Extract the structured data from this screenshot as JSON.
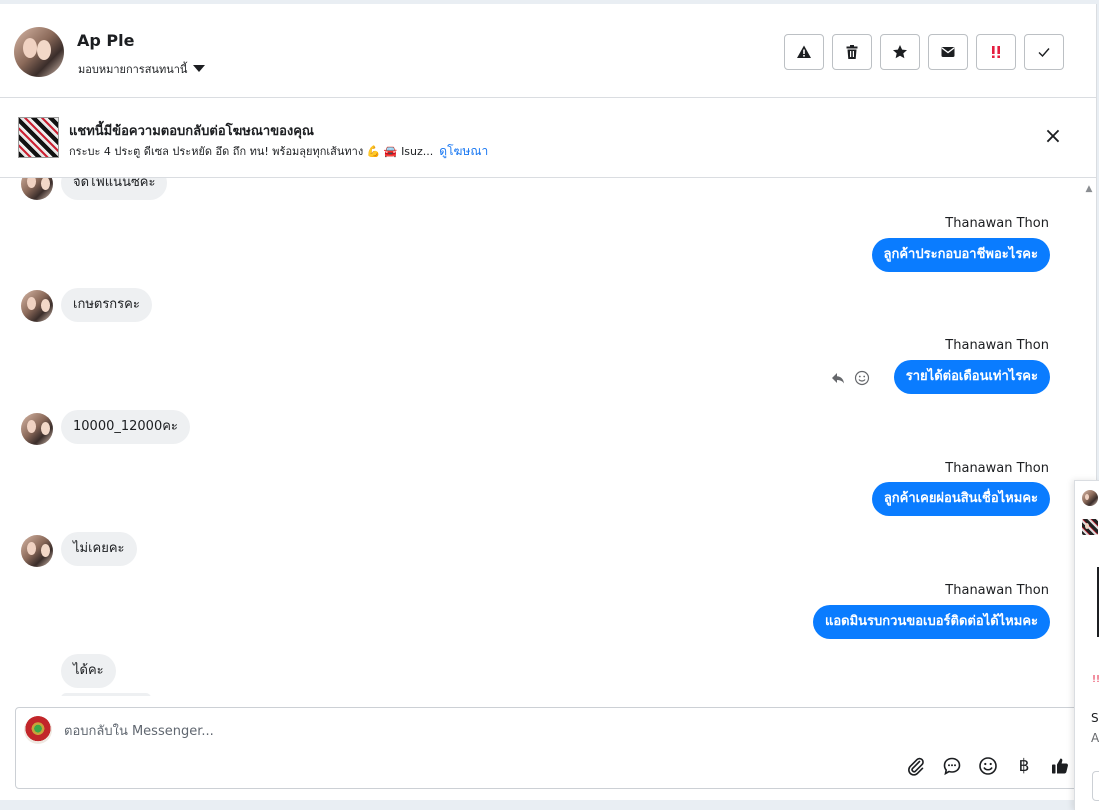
{
  "header": {
    "contact_name": "Ap Ple",
    "assign_label": "มอบหมายการสนทนานี้",
    "actions": [
      "warning-icon",
      "trash-icon",
      "star-icon",
      "mail-icon",
      "spam-icon",
      "check-icon"
    ]
  },
  "ad": {
    "title": "แชทนี้มีข้อความตอบกลับต่อโฆษณาของคุณ",
    "description": "กระบะ 4 ประตู ดีเซล ประหยัด อึด ถึก ทน! พร้อมลุยทุกเส้นทาง 💪 🚘 Isuz...",
    "link": "ดูโฆษณา",
    "close": "×"
  },
  "messages": [
    {
      "dir": "in",
      "text": "จัดไฟแนนซ์คะ"
    },
    {
      "dir": "out",
      "sender": "Thanawan Thon",
      "text": "ลูกค้าประกอบอาชีพอะไรคะ"
    },
    {
      "dir": "in",
      "text": "เกษตรกรคะ"
    },
    {
      "dir": "out",
      "sender": "Thanawan Thon",
      "text": "รายได้ต่อเดือนเท่าไรคะ"
    },
    {
      "dir": "in",
      "text": "10000_12000คะ"
    },
    {
      "dir": "out",
      "sender": "Thanawan Thon",
      "text": "ลูกค้าเคยผ่อนสินเชื่อไหมคะ"
    },
    {
      "dir": "in",
      "text": "ไม่เคยคะ"
    },
    {
      "dir": "out",
      "sender": "Thanawan Thon",
      "text": "แอดมินรบกวนขอเบอร์ติดต่อได้ไหมคะ"
    },
    {
      "dir": "in",
      "text": "ได้คะ"
    }
  ],
  "composer": {
    "placeholder": "ตอบกลับใน Messenger...",
    "tools": [
      "paperclip-icon",
      "speech-bubble-icon",
      "smiley-icon",
      "baht-icon",
      "thumbs-up-icon"
    ],
    "baht_symbol": "฿"
  },
  "peek": {
    "s_text": "S",
    "a_text": "A"
  }
}
